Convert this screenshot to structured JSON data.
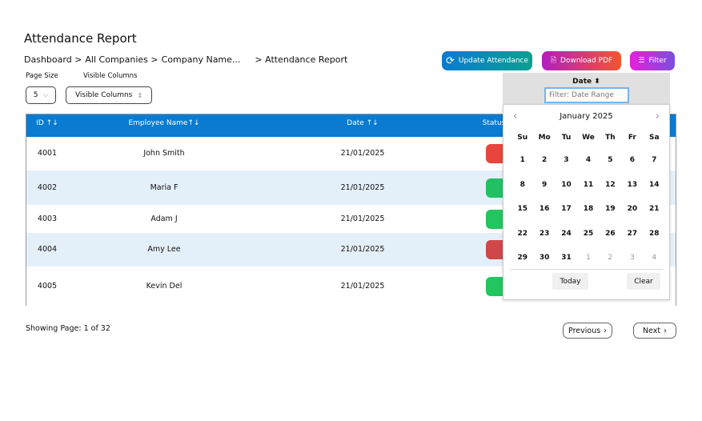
{
  "title": "Attendance Report",
  "breadcrumb": [
    "Dashboard >",
    "All Companies >",
    "Company Name...",
    "> Attendance Report"
  ],
  "controls": {
    "page_size_label": "Page Size",
    "page_size_value": "5",
    "visible_columns_label": "Visible Columns",
    "visible_columns_button": "Visible Columns"
  },
  "actions": {
    "update": "Update Attendance",
    "pdf": "Download PDF",
    "filter": "Filter"
  },
  "table": {
    "headers": [
      "ID ↑↓",
      "Employee Name↑↓",
      "Date ↑↓",
      "Status"
    ],
    "rows": [
      {
        "id": "4001",
        "name": "John Smith",
        "date": "21/01/2025",
        "status_color": "#e8453c"
      },
      {
        "id": "4002",
        "name": "Maria F",
        "date": "21/01/2025",
        "status_color": "#22c063"
      },
      {
        "id": "4003",
        "name": "Adam J",
        "date": "21/01/2025",
        "status_color": "#22c55e"
      },
      {
        "id": "4004",
        "name": "Amy Lee",
        "date": "21/01/2025",
        "status_color": "#d0474a"
      },
      {
        "id": "4005",
        "name": "Kevin Del",
        "date": "21/01/2025",
        "status_color": "#22c55e"
      }
    ]
  },
  "date_filter": {
    "header": "Date",
    "placeholder": "Filter: Date Range",
    "month": "January 2025",
    "weekdays": [
      "Su",
      "Mo",
      "Tu",
      "We",
      "Th",
      "Fr",
      "Sa"
    ],
    "days": [
      "1",
      "2",
      "3",
      "4",
      "5",
      "6",
      "7",
      "8",
      "9",
      "10",
      "11",
      "12",
      "13",
      "14",
      "15",
      "16",
      "17",
      "18",
      "19",
      "20",
      "21",
      "22",
      "23",
      "24",
      "25",
      "26",
      "27",
      "28",
      "29",
      "30",
      "31"
    ],
    "next_days": [
      "1",
      "2",
      "3",
      "4"
    ],
    "selected": "10",
    "today": "Today",
    "clear": "Clear"
  },
  "pagination": {
    "status": "Showing Page: 1 of 32",
    "previous": "Previous",
    "next": "Next"
  }
}
